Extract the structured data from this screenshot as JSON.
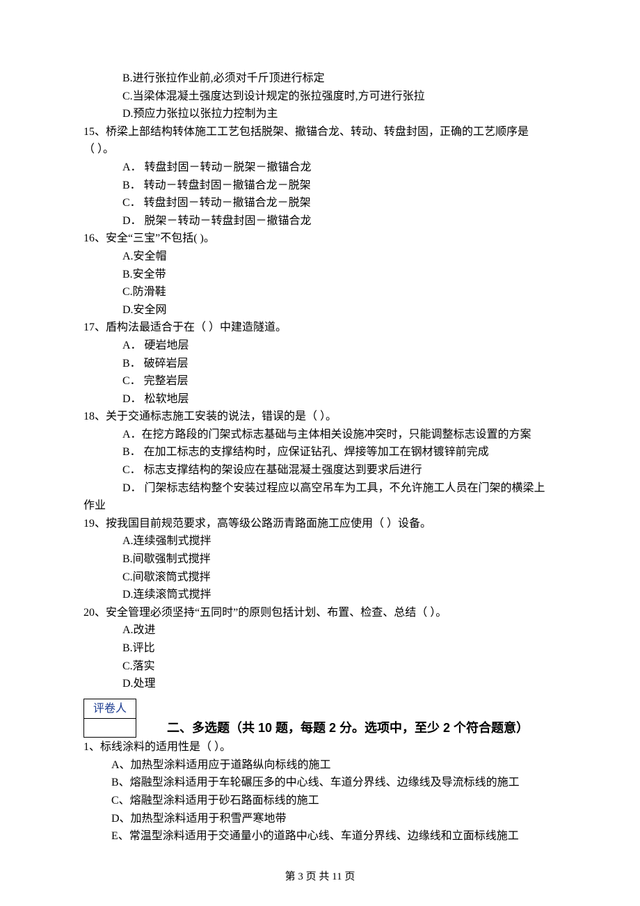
{
  "q14": {
    "optB": "B.进行张拉作业前,必须对千斤顶进行标定",
    "optC": "C.当梁体混凝土强度达到设计规定的张拉强度时,方可进行张拉",
    "optD": "D.预应力张拉以张拉力控制为主"
  },
  "q15": {
    "stem1": "15、桥梁上部结构转体施工工艺包括脱架、撤锚合龙、转动、转盘封固，正确的工艺顺序是",
    "stem2": "（     ）。",
    "optA": "A． 转盘封固－转动－脱架－撤锚合龙",
    "optB": "B． 转动－转盘封固－撤锚合龙－脱架",
    "optC": "C． 转盘封固－转动－撤锚合龙－脱架",
    "optD": "D． 脱架－转动－转盘封固－撤锚合龙"
  },
  "q16": {
    "stem": "16、安全“三宝”不包括(    )。",
    "optA": "A.安全帽",
    "optB": "B.安全带",
    "optC": "C.防滑鞋",
    "optD": "D.安全网"
  },
  "q17": {
    "stem": "17、盾构法最适合于在（    ）中建造隧道。",
    "optA": "A． 硬岩地层",
    "optB": "B． 破碎岩层",
    "optC": "C． 完整岩层",
    "optD": "D． 松软地层"
  },
  "q18": {
    "stem": "18、关于交通标志施工安装的说法，错误的是（    ）。",
    "optA": "A．在挖方路段的门架式标志基础与主体相关设施冲突时，只能调整标志设置的方案",
    "optB": "B． 在加工标志的支撑结构时，应保证钻孔、焊接等加工在钢材镀锌前完成",
    "optC": "C． 标志支撑结构的架设应在基础混凝土强度达到要求后进行",
    "optD1": "D． 门架标志结构整个安装过程应以高空吊车为工具，不允许施工人员在门架的横梁上",
    "optD2": "作业"
  },
  "q19": {
    "stem": "19、按我国目前规范要求，高等级公路沥青路面施工应使用（    ）设备。",
    "optA": "A.连续强制式搅拌",
    "optB": "B.间歇强制式搅拌",
    "optC": "C.间歇滚筒式搅拌",
    "optD": "D.连续滚筒式搅拌"
  },
  "q20": {
    "stem": "20、安全管理必须坚持“五同时”的原则包括计划、布置、检查、总结（    ）。",
    "optA": "A.改进",
    "optB": "B.评比",
    "optC": "C.落实",
    "optD": "D.处理"
  },
  "grader_label": "评卷人",
  "section2_heading": "二、多选题（共 10 题，每题 2 分。选项中，至少 2 个符合题意）",
  "s2q1": {
    "stem": "1、标线涂料的适用性是（    ）。",
    "optA": "A、加热型涂料适用应于道路纵向标线的施工",
    "optB": "B、熔融型涂料适用于车轮碾压多的中心线、车道分界线、边缘线及导流标线的施工",
    "optC": "C、熔融型涂料适用于砂石路面标线的施工",
    "optD": "D、加热型涂料适用于积雪严寒地带",
    "optE": "E、常温型涂料适用于交通量小的道路中心线、车道分界线、边缘线和立面标线施工"
  },
  "footer": "第 3 页 共 11 页"
}
